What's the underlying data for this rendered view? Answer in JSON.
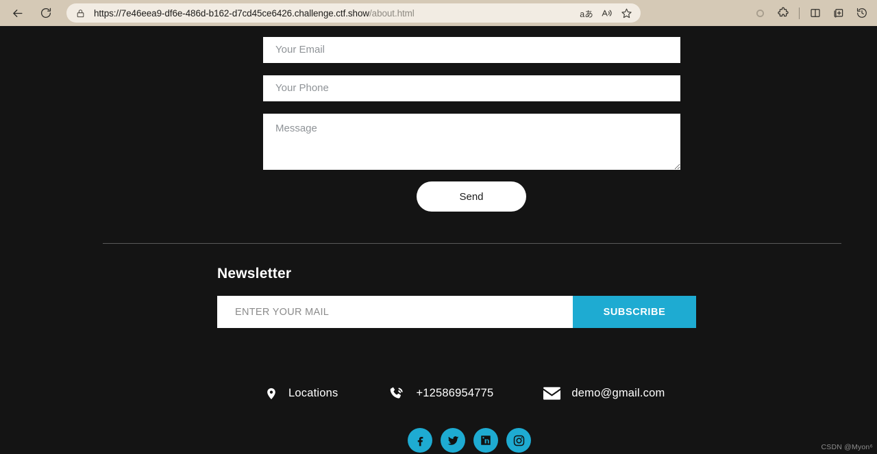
{
  "browser": {
    "back_icon": "back-arrow-icon",
    "reload_icon": "reload-icon",
    "lock_icon": "lock-icon",
    "url_domain": "https://7e46eea9-df6e-486d-b162-d7cd45ce6426.challenge.ctf.show",
    "url_path": "/about.html",
    "address_actions": [
      {
        "name": "translate-icon",
        "glyph": "aあ"
      },
      {
        "name": "read-aloud-icon",
        "glyph": "A"
      },
      {
        "name": "favorite-star-icon",
        "glyph": "☆"
      }
    ],
    "toolbar_icons": [
      {
        "name": "copilot-icon"
      },
      {
        "name": "extensions-puzzle-icon"
      },
      {
        "name": "split-screen-icon"
      },
      {
        "name": "collections-icon"
      },
      {
        "name": "history-icon"
      }
    ]
  },
  "page": {
    "background_color": "#141414",
    "accent_color": "#1eabd2"
  },
  "contact_form": {
    "email_placeholder": "Your Email",
    "email_value": "",
    "phone_placeholder": "Your Phone",
    "phone_value": "",
    "message_placeholder": "Message",
    "message_value": "",
    "send_label": "Send"
  },
  "newsletter": {
    "title": "Newsletter",
    "input_placeholder": "ENTER YOUR MAIL",
    "input_value": "",
    "subscribe_label": "SUBSCRIBE"
  },
  "contact_info": [
    {
      "icon": "location-pin-icon",
      "label": "Locations"
    },
    {
      "icon": "phone-ringing-icon",
      "label": "+12586954775"
    },
    {
      "icon": "envelope-icon",
      "label": "demo@gmail.com"
    }
  ],
  "social": [
    {
      "icon": "facebook-icon",
      "label": "Facebook"
    },
    {
      "icon": "twitter-icon",
      "label": "Twitter"
    },
    {
      "icon": "linkedin-icon",
      "label": "LinkedIn"
    },
    {
      "icon": "instagram-icon",
      "label": "Instagram"
    }
  ],
  "watermark": "CSDN @Myon⁶"
}
